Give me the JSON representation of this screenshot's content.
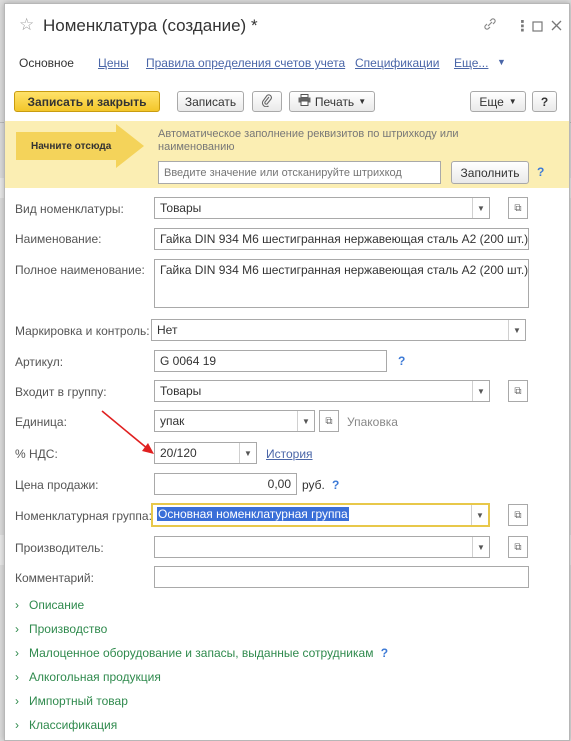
{
  "window": {
    "title": "Номенклатура (создание) *"
  },
  "tabs": [
    {
      "label": "Основное"
    },
    {
      "label": "Цены"
    },
    {
      "label": "Правила определения счетов учета"
    },
    {
      "label": "Спецификации"
    },
    {
      "label": "Еще..."
    }
  ],
  "toolbar": {
    "save_close": "Записать и закрыть",
    "save": "Записать",
    "print": "Печать",
    "more": "Еще",
    "help": "?"
  },
  "banner": {
    "start_here": "Начните отсюда",
    "hint": "Автоматическое заполнение реквизитов по штрихкоду или наименованию",
    "barcode_placeholder": "Введите значение или отсканируйте штрихкод",
    "fill_button": "Заполнить",
    "help": "?"
  },
  "form": {
    "kind": {
      "label": "Вид номенклатуры:",
      "value": "Товары"
    },
    "name": {
      "label": "Наименование:",
      "value": "Гайка DIN 934 М6 шестигранная нержавеющая сталь А2 (200 шт.)"
    },
    "full_name": {
      "label": "Полное наименование:",
      "value": "Гайка DIN 934 М6 шестигранная нержавеющая сталь А2 (200 шт.)"
    },
    "marking": {
      "label": "Маркировка и контроль:",
      "value": "Нет"
    },
    "article": {
      "label": "Артикул:",
      "value": "G 0064 19",
      "help": "?"
    },
    "group": {
      "label": "Входит в группу:",
      "value": "Товары"
    },
    "unit": {
      "label": "Единица:",
      "value": "упак",
      "note": "Упаковка"
    },
    "vat": {
      "label": "% НДС:",
      "value": "20/120",
      "history_link": "История"
    },
    "price": {
      "label": "Цена продажи:",
      "value": "0,00",
      "currency": "руб.",
      "help": "?"
    },
    "nomen_group": {
      "label": "Номенклатурная группа:",
      "value": "Основная номенклатурная группа"
    },
    "manufacturer": {
      "label": "Производитель:",
      "value": ""
    },
    "comment": {
      "label": "Комментарий:",
      "value": ""
    }
  },
  "sections": [
    {
      "label": "Описание"
    },
    {
      "label": "Производство"
    },
    {
      "label": "Малоценное оборудование и запасы, выданные сотрудникам",
      "help": "?"
    },
    {
      "label": "Алкогольная продукция"
    },
    {
      "label": "Импортный товар"
    },
    {
      "label": "Классификация"
    }
  ],
  "colors": {
    "accent_yellow": "#f3c62a",
    "banner": "#fbeeb3",
    "link": "#4a66a8",
    "section_green": "#2f8a4d",
    "selection": "#3a6fd8",
    "annotation_arrow": "#e02020"
  },
  "icons": {
    "favorite": "star-icon",
    "link": "chain-link-icon",
    "menu": "more-vertical-icon",
    "maximize": "maximize-icon",
    "close": "close-icon",
    "attach": "paperclip-icon",
    "print": "printer-icon"
  }
}
